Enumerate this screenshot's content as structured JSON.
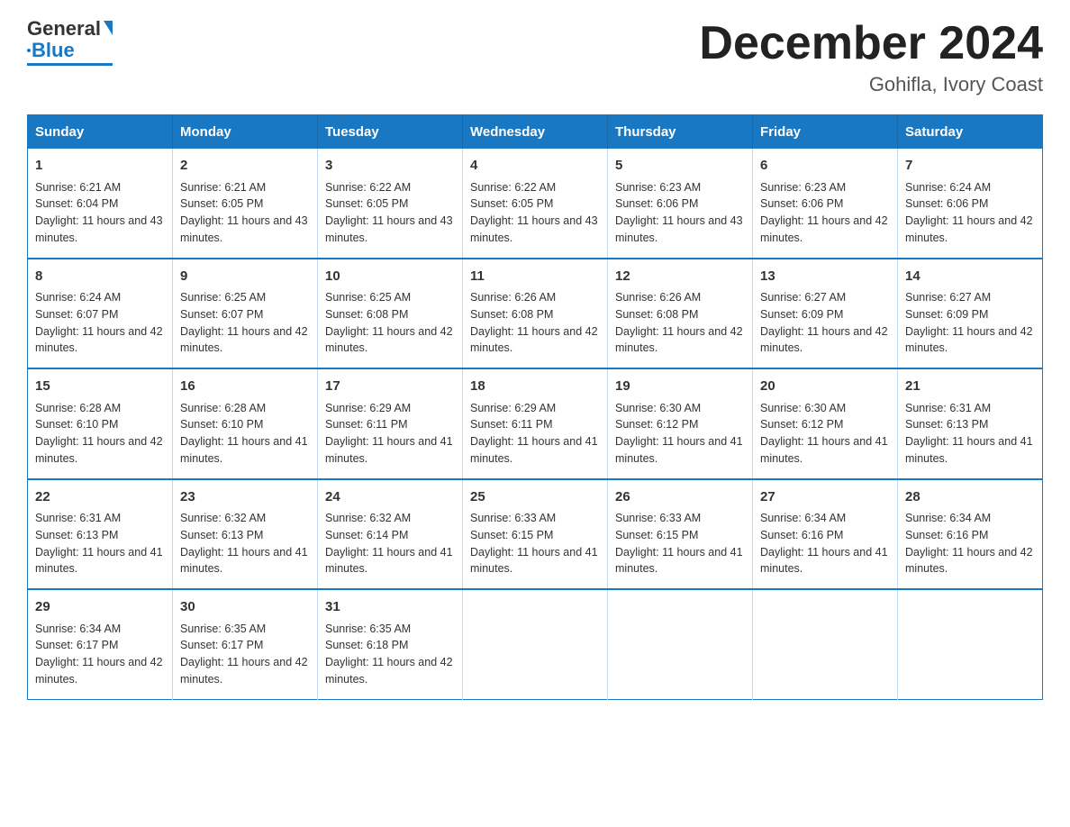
{
  "header": {
    "logo_text_general": "General",
    "logo_text_blue": "Blue",
    "month_title": "December 2024",
    "location": "Gohifla, Ivory Coast"
  },
  "days_of_week": [
    "Sunday",
    "Monday",
    "Tuesday",
    "Wednesday",
    "Thursday",
    "Friday",
    "Saturday"
  ],
  "weeks": [
    [
      {
        "day": "1",
        "sunrise": "6:21 AM",
        "sunset": "6:04 PM",
        "daylight": "11 hours and 43 minutes."
      },
      {
        "day": "2",
        "sunrise": "6:21 AM",
        "sunset": "6:05 PM",
        "daylight": "11 hours and 43 minutes."
      },
      {
        "day": "3",
        "sunrise": "6:22 AM",
        "sunset": "6:05 PM",
        "daylight": "11 hours and 43 minutes."
      },
      {
        "day": "4",
        "sunrise": "6:22 AM",
        "sunset": "6:05 PM",
        "daylight": "11 hours and 43 minutes."
      },
      {
        "day": "5",
        "sunrise": "6:23 AM",
        "sunset": "6:06 PM",
        "daylight": "11 hours and 43 minutes."
      },
      {
        "day": "6",
        "sunrise": "6:23 AM",
        "sunset": "6:06 PM",
        "daylight": "11 hours and 42 minutes."
      },
      {
        "day": "7",
        "sunrise": "6:24 AM",
        "sunset": "6:06 PM",
        "daylight": "11 hours and 42 minutes."
      }
    ],
    [
      {
        "day": "8",
        "sunrise": "6:24 AM",
        "sunset": "6:07 PM",
        "daylight": "11 hours and 42 minutes."
      },
      {
        "day": "9",
        "sunrise": "6:25 AM",
        "sunset": "6:07 PM",
        "daylight": "11 hours and 42 minutes."
      },
      {
        "day": "10",
        "sunrise": "6:25 AM",
        "sunset": "6:08 PM",
        "daylight": "11 hours and 42 minutes."
      },
      {
        "day": "11",
        "sunrise": "6:26 AM",
        "sunset": "6:08 PM",
        "daylight": "11 hours and 42 minutes."
      },
      {
        "day": "12",
        "sunrise": "6:26 AM",
        "sunset": "6:08 PM",
        "daylight": "11 hours and 42 minutes."
      },
      {
        "day": "13",
        "sunrise": "6:27 AM",
        "sunset": "6:09 PM",
        "daylight": "11 hours and 42 minutes."
      },
      {
        "day": "14",
        "sunrise": "6:27 AM",
        "sunset": "6:09 PM",
        "daylight": "11 hours and 42 minutes."
      }
    ],
    [
      {
        "day": "15",
        "sunrise": "6:28 AM",
        "sunset": "6:10 PM",
        "daylight": "11 hours and 42 minutes."
      },
      {
        "day": "16",
        "sunrise": "6:28 AM",
        "sunset": "6:10 PM",
        "daylight": "11 hours and 41 minutes."
      },
      {
        "day": "17",
        "sunrise": "6:29 AM",
        "sunset": "6:11 PM",
        "daylight": "11 hours and 41 minutes."
      },
      {
        "day": "18",
        "sunrise": "6:29 AM",
        "sunset": "6:11 PM",
        "daylight": "11 hours and 41 minutes."
      },
      {
        "day": "19",
        "sunrise": "6:30 AM",
        "sunset": "6:12 PM",
        "daylight": "11 hours and 41 minutes."
      },
      {
        "day": "20",
        "sunrise": "6:30 AM",
        "sunset": "6:12 PM",
        "daylight": "11 hours and 41 minutes."
      },
      {
        "day": "21",
        "sunrise": "6:31 AM",
        "sunset": "6:13 PM",
        "daylight": "11 hours and 41 minutes."
      }
    ],
    [
      {
        "day": "22",
        "sunrise": "6:31 AM",
        "sunset": "6:13 PM",
        "daylight": "11 hours and 41 minutes."
      },
      {
        "day": "23",
        "sunrise": "6:32 AM",
        "sunset": "6:13 PM",
        "daylight": "11 hours and 41 minutes."
      },
      {
        "day": "24",
        "sunrise": "6:32 AM",
        "sunset": "6:14 PM",
        "daylight": "11 hours and 41 minutes."
      },
      {
        "day": "25",
        "sunrise": "6:33 AM",
        "sunset": "6:15 PM",
        "daylight": "11 hours and 41 minutes."
      },
      {
        "day": "26",
        "sunrise": "6:33 AM",
        "sunset": "6:15 PM",
        "daylight": "11 hours and 41 minutes."
      },
      {
        "day": "27",
        "sunrise": "6:34 AM",
        "sunset": "6:16 PM",
        "daylight": "11 hours and 41 minutes."
      },
      {
        "day": "28",
        "sunrise": "6:34 AM",
        "sunset": "6:16 PM",
        "daylight": "11 hours and 42 minutes."
      }
    ],
    [
      {
        "day": "29",
        "sunrise": "6:34 AM",
        "sunset": "6:17 PM",
        "daylight": "11 hours and 42 minutes."
      },
      {
        "day": "30",
        "sunrise": "6:35 AM",
        "sunset": "6:17 PM",
        "daylight": "11 hours and 42 minutes."
      },
      {
        "day": "31",
        "sunrise": "6:35 AM",
        "sunset": "6:18 PM",
        "daylight": "11 hours and 42 minutes."
      },
      null,
      null,
      null,
      null
    ]
  ],
  "labels": {
    "sunrise": "Sunrise:",
    "sunset": "Sunset:",
    "daylight": "Daylight:"
  }
}
